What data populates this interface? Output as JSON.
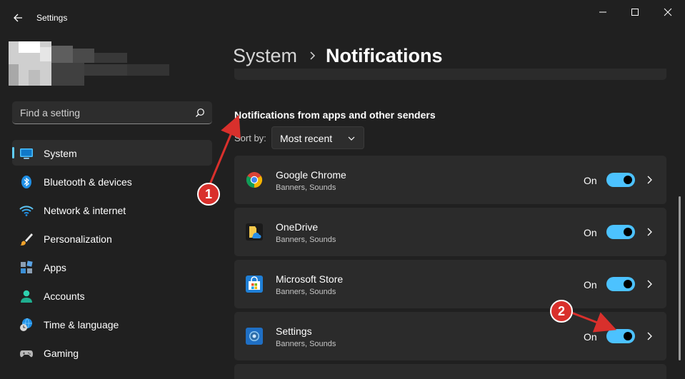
{
  "window": {
    "title": "Settings",
    "controls": [
      "minimize-icon",
      "maximize-icon",
      "close-icon"
    ]
  },
  "search": {
    "placeholder": "Find a setting"
  },
  "sidebar": {
    "items": [
      {
        "label": "System",
        "icon": "system-icon",
        "selected": true
      },
      {
        "label": "Bluetooth & devices",
        "icon": "bluetooth-icon"
      },
      {
        "label": "Network & internet",
        "icon": "wifi-icon"
      },
      {
        "label": "Personalization",
        "icon": "brush-icon"
      },
      {
        "label": "Apps",
        "icon": "apps-icon"
      },
      {
        "label": "Accounts",
        "icon": "accounts-icon"
      },
      {
        "label": "Time & language",
        "icon": "globe-clock-icon"
      },
      {
        "label": "Gaming",
        "icon": "gamepad-icon"
      }
    ]
  },
  "breadcrumb": {
    "parent": "System",
    "current": "Notifications"
  },
  "section": {
    "title": "Notifications from apps and other senders",
    "sort_label": "Sort by:",
    "sort_value": "Most recent"
  },
  "apps": [
    {
      "name": "Google Chrome",
      "detail": "Banners, Sounds",
      "state": "On",
      "enabled": true,
      "icon": "chrome-icon"
    },
    {
      "name": "OneDrive",
      "detail": "Banners, Sounds",
      "state": "On",
      "enabled": true,
      "icon": "onedrive-icon"
    },
    {
      "name": "Microsoft Store",
      "detail": "Banners, Sounds",
      "state": "On",
      "enabled": true,
      "icon": "store-icon"
    },
    {
      "name": "Settings",
      "detail": "Banners, Sounds",
      "state": "On",
      "enabled": true,
      "icon": "settings-gear-icon"
    }
  ],
  "annotations": [
    {
      "label": "1"
    },
    {
      "label": "2"
    }
  ],
  "colors": {
    "accent": "#4cc2ff",
    "background": "#202020",
    "card": "#2b2b2b",
    "annotation": "#d9302c"
  }
}
